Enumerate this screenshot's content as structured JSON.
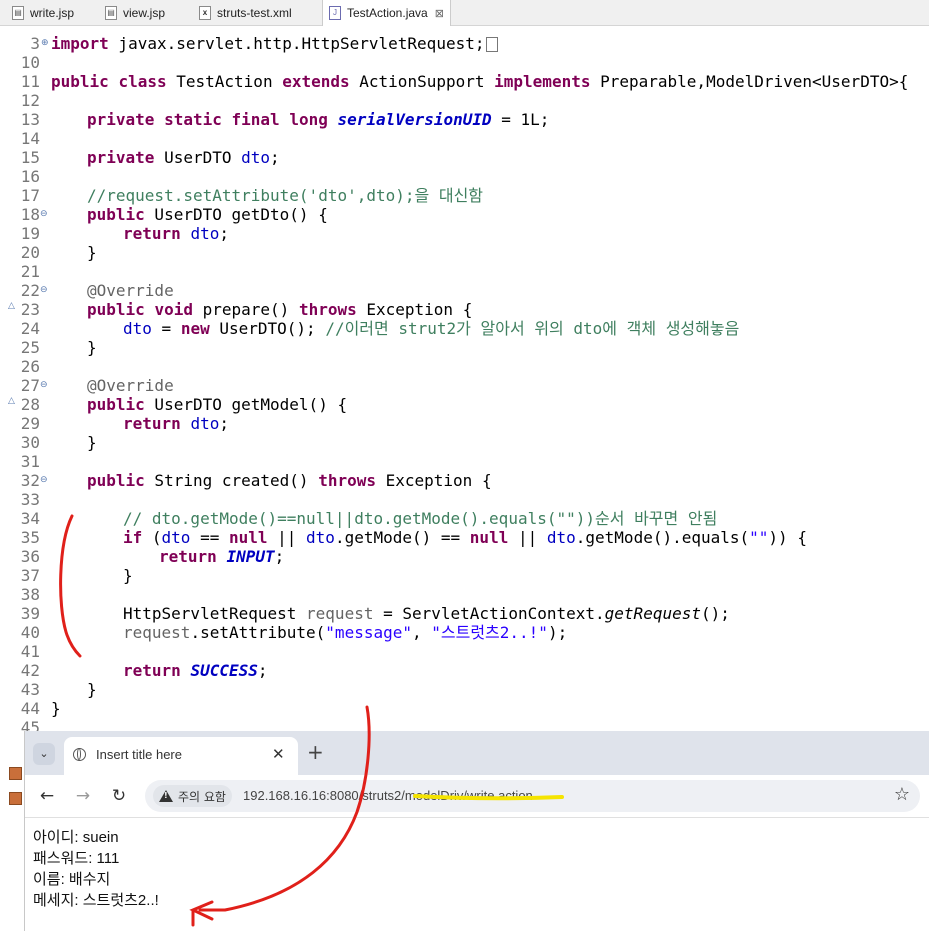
{
  "editor_tabs": [
    {
      "label": "write.jsp",
      "icon": "jsp-file-icon"
    },
    {
      "label": "view.jsp",
      "icon": "jsp-file-icon"
    },
    {
      "label": "struts-test.xml",
      "icon": "xml-file-icon"
    },
    {
      "label": "TestAction.java",
      "icon": "java-file-icon",
      "active": true
    }
  ],
  "editor_tab_close": "⊠",
  "line_numbers": [
    "3",
    "10",
    "11",
    "12",
    "13",
    "14",
    "15",
    "16",
    "17",
    "18",
    "19",
    "20",
    "21",
    "22",
    "23",
    "24",
    "25",
    "26",
    "27",
    "28",
    "29",
    "30",
    "31",
    "32",
    "33",
    "34",
    "35",
    "36",
    "37",
    "38",
    "39",
    "40",
    "41",
    "42",
    "43",
    "44",
    "45"
  ],
  "code": {
    "l3": [
      "import",
      " javax.servlet.http.HttpServletRequest;"
    ],
    "l11": [
      "public",
      " ",
      "class",
      " TestAction ",
      "extends",
      " ActionSupport ",
      "implements",
      " Preparable,ModelDriven<UserDTO>{"
    ],
    "l13": [
      "private",
      " ",
      "static",
      " ",
      "final",
      " ",
      "long",
      " ",
      "serialVersionUID",
      " = 1L;"
    ],
    "l15": [
      "private",
      " UserDTO ",
      "dto",
      ";"
    ],
    "l17": "//request.setAttribute('dto',dto);을 대신함",
    "l18": [
      "public",
      " UserDTO getDto() {"
    ],
    "l19": [
      "return",
      " ",
      "dto",
      ";"
    ],
    "l20": "}",
    "l22": "@Override",
    "l23": [
      "public",
      " ",
      "void",
      " prepare() ",
      "throws",
      " Exception {"
    ],
    "l24": [
      "dto",
      " = ",
      "new",
      " UserDTO(); ",
      "//이러면 strut2가 알아서 위의 dto에 객체 생성해놓음"
    ],
    "l25": "}",
    "l27": "@Override",
    "l28": [
      "public",
      " UserDTO getModel() {"
    ],
    "l29": [
      "return",
      " ",
      "dto",
      ";"
    ],
    "l30": "}",
    "l32": [
      "public",
      " String created() ",
      "throws",
      " Exception {"
    ],
    "l34": "// dto.getMode()==null||dto.getMode().equals(\"\"))순서 바꾸면 안됨",
    "l35": [
      "if",
      " (",
      "dto",
      " == ",
      "null",
      " || ",
      "dto",
      ".getMode() == ",
      "null",
      " || ",
      "dto",
      ".getMode().equals(",
      "\"\"",
      ")) {"
    ],
    "l36": [
      "return",
      " ",
      "INPUT",
      ";"
    ],
    "l37": "}",
    "l39": [
      "HttpServletRequest ",
      "request",
      " = ServletActionContext.",
      "getRequest",
      "();"
    ],
    "l40": [
      "request",
      ".setAttribute(",
      "\"message\"",
      ", ",
      "\"스트럿츠2..!\"",
      ");"
    ],
    "l42": [
      "return",
      " ",
      "SUCCESS",
      ";"
    ],
    "l43": "}",
    "l44": "}"
  },
  "browser": {
    "tab_title": "Insert title here",
    "tab_close": "✕",
    "new_tab": "+",
    "tab_list": "⌄",
    "back": "←",
    "forward": "→",
    "reload": "↻",
    "security_chip": "주의 요함",
    "url": "192.168.16.16:8080/struts2/modelDriv/write.action",
    "star": "☆",
    "page_lines": [
      "아이디: suein",
      "패스워드: 111",
      "이름: 배수지",
      "메세지: 스트럿츠2..!"
    ]
  },
  "colors": {
    "keyword": "#7f0055",
    "field": "#0000c0",
    "string": "#2a00ff",
    "comment": "#3f7f5f",
    "annotation_pen": "#e0201a",
    "url_highlight": "#f5e400"
  }
}
